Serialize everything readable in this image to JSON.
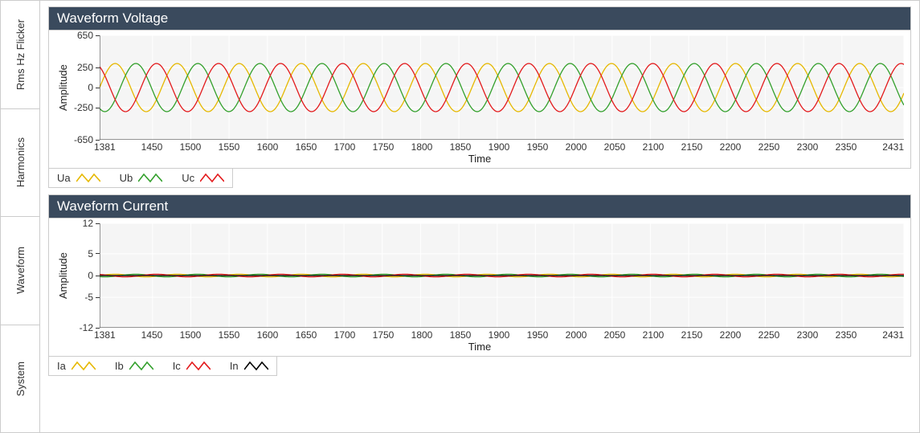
{
  "sidebar": {
    "tabs": [
      {
        "id": "rms",
        "label": "Rms Hz Flicker"
      },
      {
        "id": "harmonics",
        "label": "Harmonics"
      },
      {
        "id": "waveform",
        "label": "Waveform"
      },
      {
        "id": "system",
        "label": "System"
      }
    ],
    "active": "waveform"
  },
  "charts": [
    {
      "id": "voltage",
      "title": "Waveform Voltage",
      "xlabel": "Time",
      "ylabel": "Amplitude",
      "x_range": [
        1381,
        2431
      ],
      "x_ticks": [
        1381,
        1450,
        1500,
        1550,
        1600,
        1650,
        1700,
        1750,
        1800,
        1850,
        1900,
        1950,
        2000,
        2050,
        2100,
        2150,
        2200,
        2250,
        2300,
        2350,
        2431
      ],
      "y_range": [
        -650,
        650
      ],
      "y_ticks": [
        650,
        250,
        0,
        -250,
        -650
      ],
      "series": [
        {
          "name": "Ua",
          "color": "#e6b800",
          "amplitude": 300,
          "period": 81,
          "phase": 0
        },
        {
          "name": "Ub",
          "color": "#33a02c",
          "amplitude": 300,
          "period": 81,
          "phase": -120
        },
        {
          "name": "Uc",
          "color": "#e31a1c",
          "amplitude": 300,
          "period": 81,
          "phase": 120
        }
      ],
      "legend": [
        "Ua",
        "Ub",
        "Uc"
      ]
    },
    {
      "id": "current",
      "title": "Waveform Current",
      "xlabel": "Time",
      "ylabel": "Amplitude",
      "x_range": [
        1381,
        2431
      ],
      "x_ticks": [
        1381,
        1450,
        1500,
        1550,
        1600,
        1650,
        1700,
        1750,
        1800,
        1850,
        1900,
        1950,
        2000,
        2050,
        2100,
        2150,
        2200,
        2250,
        2300,
        2350,
        2431
      ],
      "y_range": [
        -12,
        12
      ],
      "y_ticks": [
        12,
        5,
        0,
        -5,
        -12
      ],
      "series": [
        {
          "name": "Ia",
          "color": "#e6b800",
          "amplitude": 0.3,
          "period": 81,
          "phase": 0
        },
        {
          "name": "Ib",
          "color": "#33a02c",
          "amplitude": 0.3,
          "period": 81,
          "phase": -120
        },
        {
          "name": "Ic",
          "color": "#e31a1c",
          "amplitude": 0.3,
          "period": 81,
          "phase": 120
        },
        {
          "name": "In",
          "color": "#000000",
          "amplitude": 0.0,
          "period": 81,
          "phase": 0
        }
      ],
      "legend": [
        "Ia",
        "Ib",
        "Ic",
        "In"
      ]
    }
  ],
  "chart_data": [
    {
      "type": "line",
      "title": "Waveform Voltage",
      "xlabel": "Time",
      "ylabel": "Amplitude",
      "xlim": [
        1381,
        2431
      ],
      "ylim": [
        -650,
        650
      ],
      "x_ticks": [
        1381,
        1450,
        1500,
        1550,
        1600,
        1650,
        1700,
        1750,
        1800,
        1850,
        1900,
        1950,
        2000,
        2050,
        2100,
        2150,
        2200,
        2250,
        2300,
        2350,
        2431
      ],
      "y_ticks": [
        -650,
        -250,
        0,
        250,
        650
      ],
      "series": [
        {
          "name": "Ua",
          "color": "#e6b800",
          "form": "sinusoid",
          "amplitude": 300,
          "period": 81,
          "phase_deg": 0
        },
        {
          "name": "Ub",
          "color": "#33a02c",
          "form": "sinusoid",
          "amplitude": 300,
          "period": 81,
          "phase_deg": -120
        },
        {
          "name": "Uc",
          "color": "#e31a1c",
          "form": "sinusoid",
          "amplitude": 300,
          "period": 81,
          "phase_deg": 120
        }
      ]
    },
    {
      "type": "line",
      "title": "Waveform Current",
      "xlabel": "Time",
      "ylabel": "Amplitude",
      "xlim": [
        1381,
        2431
      ],
      "ylim": [
        -12,
        12
      ],
      "x_ticks": [
        1381,
        1450,
        1500,
        1550,
        1600,
        1650,
        1700,
        1750,
        1800,
        1850,
        1900,
        1950,
        2000,
        2050,
        2100,
        2150,
        2200,
        2250,
        2300,
        2350,
        2431
      ],
      "y_ticks": [
        -12,
        -5,
        0,
        5,
        12
      ],
      "series": [
        {
          "name": "Ia",
          "color": "#e6b800",
          "form": "sinusoid",
          "amplitude": 0.3,
          "period": 81,
          "phase_deg": 0
        },
        {
          "name": "Ib",
          "color": "#33a02c",
          "form": "sinusoid",
          "amplitude": 0.3,
          "period": 81,
          "phase_deg": -120
        },
        {
          "name": "Ic",
          "color": "#e31a1c",
          "form": "sinusoid",
          "amplitude": 0.3,
          "period": 81,
          "phase_deg": 120
        },
        {
          "name": "In",
          "color": "#000000",
          "form": "constant",
          "amplitude": 0,
          "period": 81,
          "phase_deg": 0
        }
      ]
    }
  ]
}
